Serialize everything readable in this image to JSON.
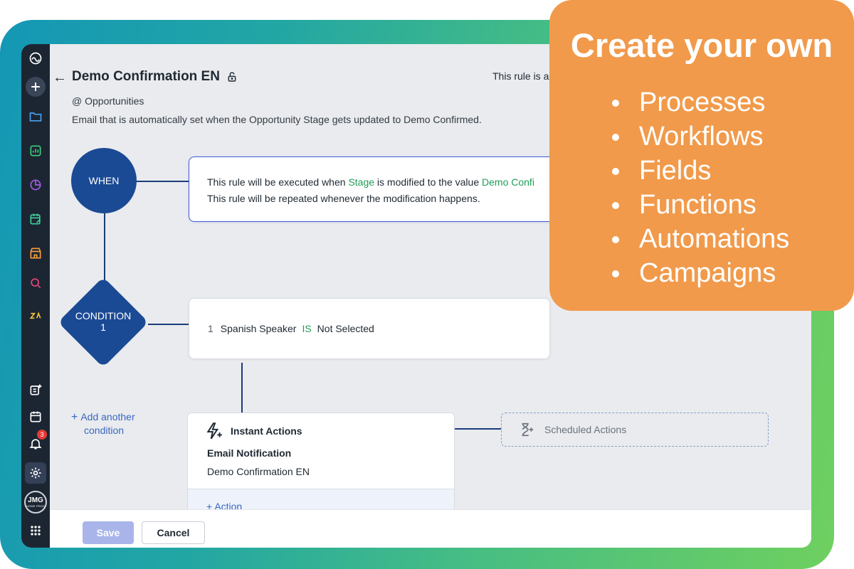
{
  "header": {
    "back_label": "←",
    "title": "Demo Confirmation EN",
    "rule_status": "This rule is ac",
    "module": "@ Opportunities",
    "description": "Email that is automatically set when the Opportunity Stage gets updated to Demo Confirmed."
  },
  "sidebar": {
    "notification_count": "3",
    "avatar_initials": "JMG",
    "avatar_sub": "HOME PROS"
  },
  "when": {
    "label": "WHEN",
    "line1_prefix": "This rule will be executed when ",
    "line1_field": "Stage",
    "line1_mid": " is modified to the value ",
    "line1_value": "Demo Confi",
    "line2": "This rule will be repeated whenever the modification happens."
  },
  "condition": {
    "label_line1": "CONDITION",
    "label_line2": "1",
    "number": "1",
    "field": "Spanish Speaker",
    "operator": "IS",
    "value": "Not Selected",
    "add_link_line1": "Add another",
    "add_link_line2": "condition",
    "add_plus": "+"
  },
  "instant_actions": {
    "title": "Instant Actions",
    "type": "Email Notification",
    "value": "Demo Confirmation EN",
    "add_action": "Action",
    "add_plus": "+"
  },
  "scheduled_actions": {
    "label": "Scheduled Actions"
  },
  "footer": {
    "save_label": "Save",
    "cancel_label": "Cancel"
  },
  "callout": {
    "title": "Create your own",
    "items": [
      "Processes",
      "Workflows",
      "Fields",
      "Functions",
      "Automations",
      "Campaigns"
    ]
  },
  "colors": {
    "brand_blue": "#1b4a94",
    "accent_orange": "#f19a4b",
    "link_blue": "#3a67c4",
    "value_green": "#1e9e57",
    "sidebar_dark": "#1c2633"
  }
}
